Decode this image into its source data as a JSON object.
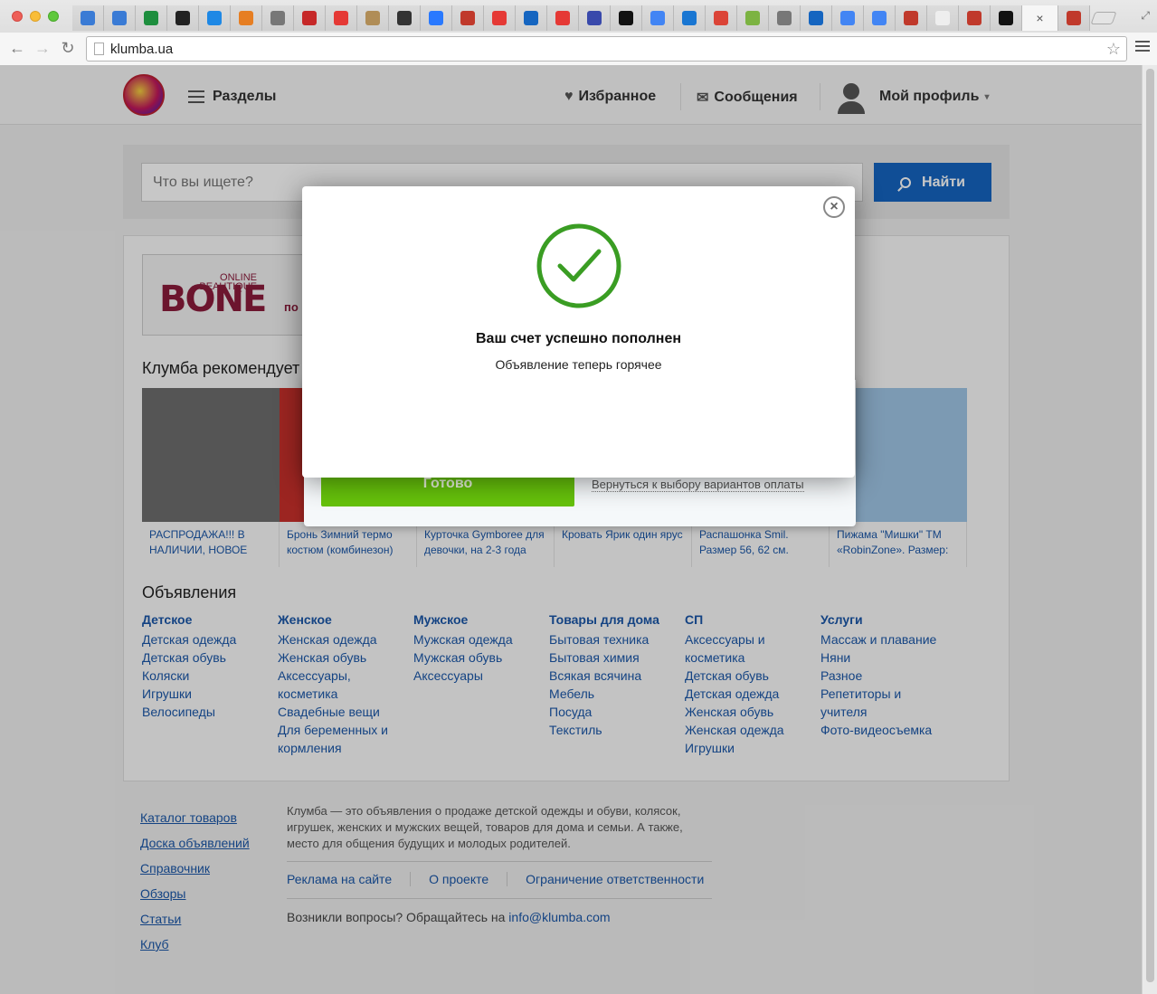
{
  "browser": {
    "url": "klumba.ua",
    "tab_favicons": [
      "#3a7bd5",
      "#3a7bd5",
      "#1e8e3e",
      "#222",
      "#1e88e5",
      "#e67e22",
      "#777",
      "#c62828",
      "#e53935",
      "#b08d57",
      "#333",
      "#2979ff",
      "#c0392b",
      "#e53935",
      "#1565c0",
      "#e53935",
      "#3949ab",
      "#111",
      "#4285f4",
      "#1976d2",
      "#db4437",
      "#7cb342",
      "#777",
      "#1565c0",
      "#4285f4",
      "#4285f4",
      "#c0392b",
      "#eee",
      "#c0392b",
      "#111",
      "#c0392b"
    ]
  },
  "header": {
    "sections_label": "Разделы",
    "favorites_label": "Избранное",
    "messages_label": "Сообщения",
    "profile_label": "Мой профиль"
  },
  "search": {
    "placeholder": "Что вы ищете?",
    "button_label": "Найти"
  },
  "banner": {
    "small_text_1": "ONLINE",
    "small_text_2": "BEAUTIQUE",
    "brand": "BONE",
    "text": "по"
  },
  "recommend": {
    "title": "Клумба рекомендует",
    "items": [
      {
        "caption": "РАСПРОДАЖА!!! В НАЛИЧИИ, НОВОЕ",
        "color": "#6d6d6d"
      },
      {
        "caption": "Бронь Зимний термо костюм (комбинезон)",
        "color": "#c8302b"
      },
      {
        "caption": "Курточка Gymboree для девочки, на 2-3 года",
        "color": "#c9a07a"
      },
      {
        "caption": "Кровать Ярик один ярус",
        "color": "#b9d3e6"
      },
      {
        "caption": "Распашонка Smil. Размер 56, 62 см.",
        "color": "#e9c9d6"
      },
      {
        "caption": "Пижама \"Мишки\" ТМ «RobinZone». Размер:",
        "color": "#9fc6e6"
      }
    ]
  },
  "ads": {
    "title": "Объявления",
    "columns": [
      {
        "head": "Детское",
        "links": [
          "Детская одежда",
          "Детская обувь",
          "Коляски",
          "Игрушки",
          "Велосипеды"
        ]
      },
      {
        "head": "Женское",
        "links": [
          "Женская одежда",
          "Женская обувь",
          "Аксессуары,",
          "косметика",
          "Свадебные вещи",
          "Для беременных и",
          "кормления"
        ]
      },
      {
        "head": "Мужское",
        "links": [
          "Мужская одежда",
          "Мужская обувь",
          "Аксессуары"
        ]
      },
      {
        "head": "Товары для дома",
        "links": [
          "Бытовая техника",
          "Бытовая химия",
          "Всякая всячина",
          "Мебель",
          "Посуда",
          "Текстиль"
        ]
      },
      {
        "head": "СП",
        "links": [
          "Аксессуары и",
          "косметика",
          "Детская обувь",
          "Детская одежда",
          "Женская обувь",
          "Женская одежда",
          "Игрушки"
        ]
      },
      {
        "head": "Услуги",
        "links": [
          "Массаж и плавание",
          "Няни",
          "Разное",
          "Репетиторы и",
          "учителя",
          "Фото-видеосъемка"
        ]
      }
    ]
  },
  "footer": {
    "links": [
      "Каталог товаров",
      "Доска объявлений",
      "Справочник",
      "Обзоры",
      "Статьи",
      "Клуб"
    ],
    "about": "Клумба — это объявления о продаже детской одежды и обуви, колясок, игрушек, женских и мужских вещей, товаров для дома и семьи. А также, место для общения будущих и молодых родителей.",
    "nav": [
      "Реклама на сайте",
      "О проекте",
      "Ограничение ответственности"
    ],
    "contact_text": "Возникли вопросы? Обращайтесь на ",
    "contact_email": "info@klumba.com"
  },
  "payment": {
    "ready_label": "Готово",
    "back_label": "Вернуться к выбору вариантов оплаты"
  },
  "modal": {
    "title": "Ваш счет успешно пополнен",
    "subtitle": "Объявление теперь горячее",
    "accent": "#3a9d23"
  }
}
